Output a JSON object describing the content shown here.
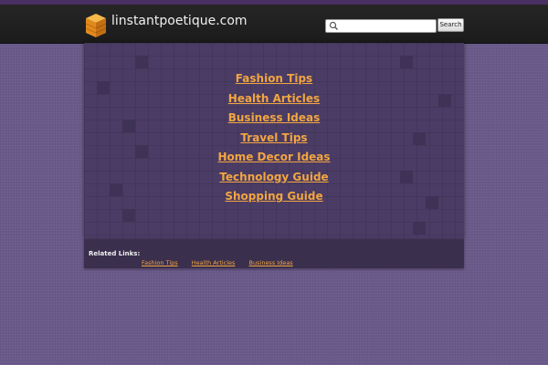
{
  "header": {
    "site_title": "linstantpoetique.com",
    "search": {
      "placeholder": "",
      "value": "",
      "button_label": "Search"
    }
  },
  "main": {
    "links": [
      {
        "label": "Fashion Tips"
      },
      {
        "label": "Health Articles"
      },
      {
        "label": "Business Ideas"
      },
      {
        "label": "Travel Tips"
      },
      {
        "label": "Home Decor Ideas"
      },
      {
        "label": "Technology Guide"
      },
      {
        "label": "Shopping Guide"
      }
    ]
  },
  "related": {
    "label": "Related Links:",
    "links": [
      {
        "label": "Fashion Tips"
      },
      {
        "label": "Health Articles"
      },
      {
        "label": "Business Ideas"
      }
    ]
  },
  "colors": {
    "page_background": "#6a5a8a",
    "header_background": "#1f1f1f",
    "panel_background": "#4a3c64",
    "link_color": "#f2a541",
    "logo_color": "#f0a030"
  },
  "icons": {
    "logo": "orange-cube-stack-icon",
    "search": "magnifier-icon"
  }
}
